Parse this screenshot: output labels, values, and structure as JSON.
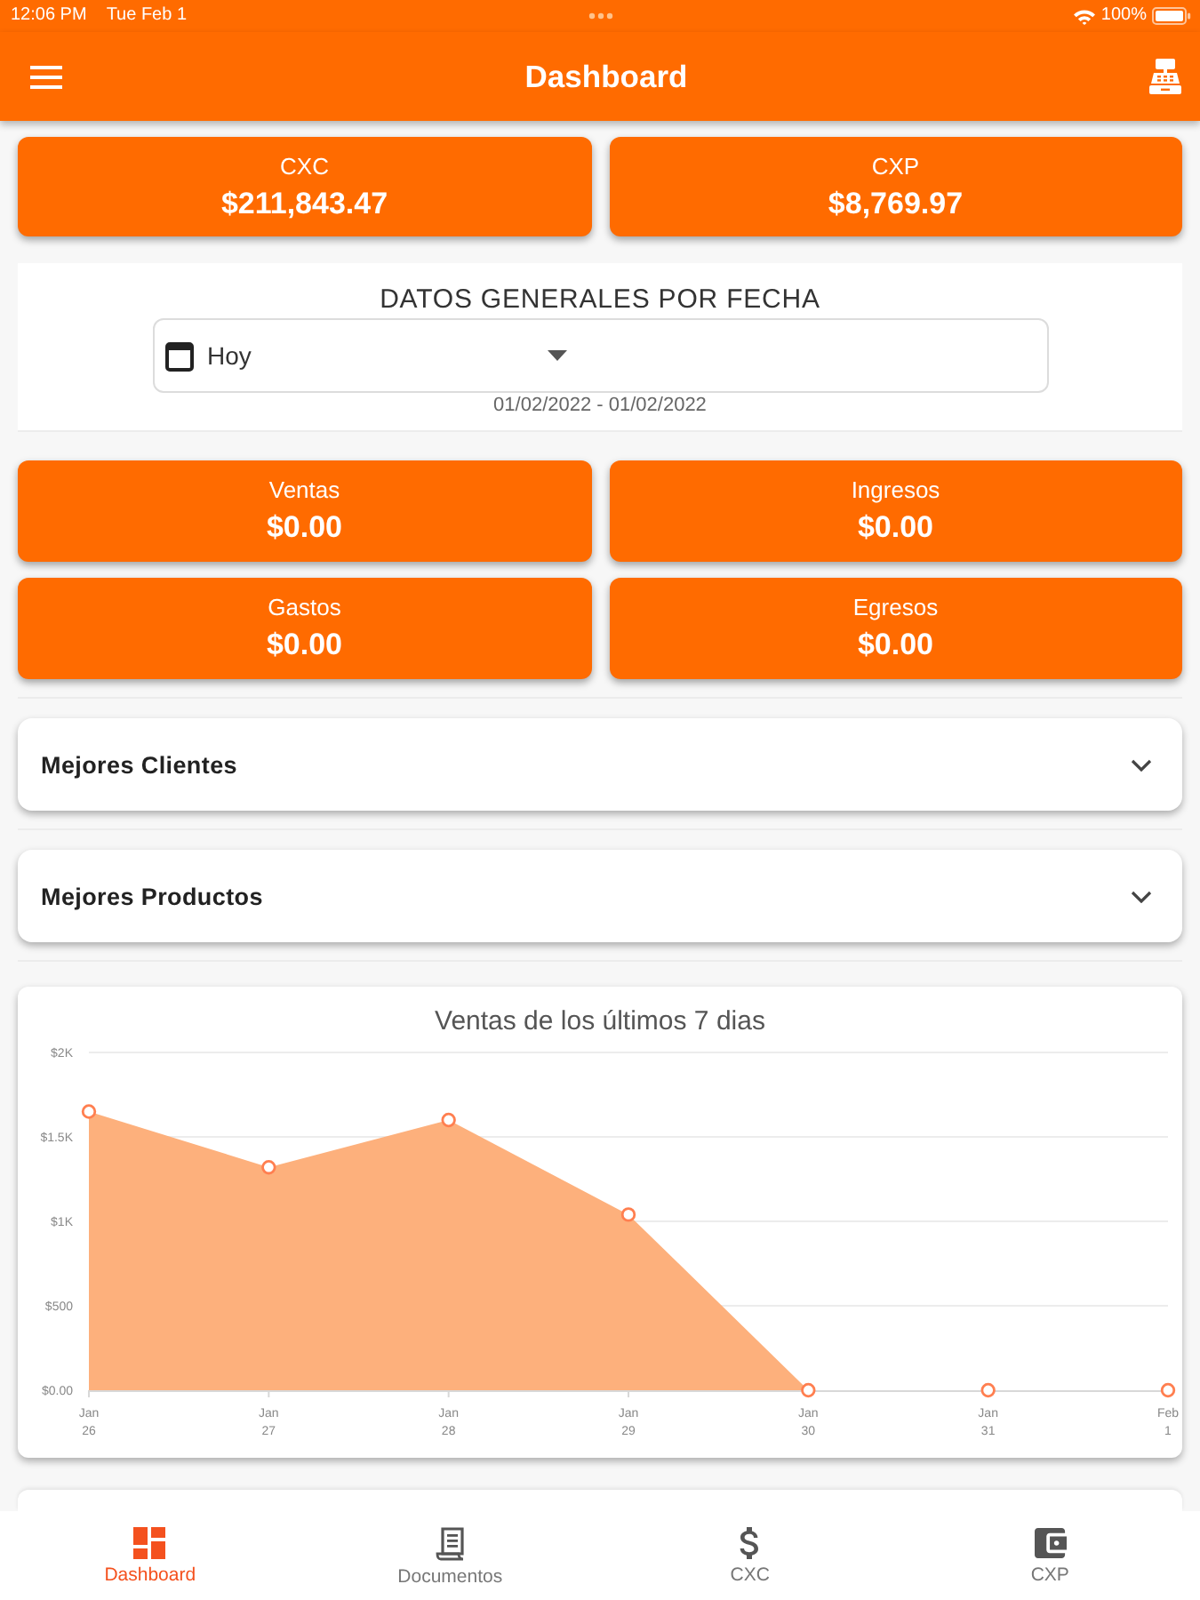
{
  "status_bar": {
    "time": "12:06 PM",
    "date": "Tue Feb 1",
    "battery": "100%"
  },
  "header": {
    "title": "Dashboard"
  },
  "balance_cards": [
    {
      "label": "CXC",
      "amount": "$211,843.47"
    },
    {
      "label": "CXP",
      "amount": "$8,769.97"
    }
  ],
  "date_filter": {
    "title": "DATOS GENERALES POR FECHA",
    "value": "Hoy",
    "range": "01/02/2022 - 01/02/2022"
  },
  "summary_cards": [
    {
      "label": "Ventas",
      "amount": "$0.00"
    },
    {
      "label": "Ingresos",
      "amount": "$0.00"
    },
    {
      "label": "Gastos",
      "amount": "$0.00"
    },
    {
      "label": "Egresos",
      "amount": "$0.00"
    }
  ],
  "sections": [
    {
      "title": "Mejores Clientes",
      "expanded": false
    },
    {
      "title": "Mejores Productos",
      "expanded": false
    }
  ],
  "chart_card": {
    "chart_data": {
      "type": "area",
      "title": "Ventas de los últimos 7 dias",
      "categories": [
        "Jan 26",
        "Jan 27",
        "Jan 28",
        "Jan 29",
        "Jan 30",
        "Jan 31",
        "Feb 1"
      ],
      "series": [
        {
          "color": "#fdb07c",
          "values": [
            1650,
            1320,
            1600,
            1040,
            0,
            0,
            0
          ]
        }
      ],
      "ylim": [
        0,
        2000
      ],
      "yticks": [
        {
          "value": 0,
          "label": "$0.00"
        },
        {
          "value": 500,
          "label": "$500"
        },
        {
          "value": 1000,
          "label": "$1K"
        },
        {
          "value": 1500,
          "label": "$1.5K"
        },
        {
          "value": 2000,
          "label": "$2K"
        }
      ],
      "grid": true
    }
  },
  "bottom_nav": [
    {
      "label": "Dashboard",
      "selected": true
    },
    {
      "label": "Documentos",
      "selected": false
    },
    {
      "label": "CXC",
      "selected": false
    },
    {
      "label": "CXP",
      "selected": false
    }
  ]
}
